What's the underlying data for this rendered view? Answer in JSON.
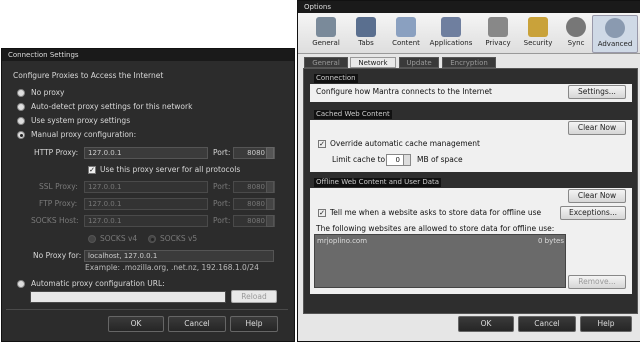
{
  "connection": {
    "title": "Connection Settings",
    "heading": "Configure Proxies to Access the Internet",
    "opt_no_proxy": "No proxy",
    "opt_auto_detect": "Auto-detect proxy settings for this network",
    "opt_system": "Use system proxy settings",
    "opt_manual": "Manual proxy configuration:",
    "http_label": "HTTP Proxy:",
    "http_value": "127.0.0.1",
    "port_label": "Port:",
    "http_port": "8080",
    "use_same": "Use this proxy server for all protocols",
    "ssl_label": "SSL Proxy:",
    "ssl_value": "127.0.0.1",
    "ssl_port": "8080",
    "ftp_label": "FTP Proxy:",
    "ftp_value": "127.0.0.1",
    "ftp_port": "8080",
    "socks_label": "SOCKS Host:",
    "socks_value": "127.0.0.1",
    "socks_port": "8080",
    "socks_v4": "SOCKS v4",
    "socks_v5": "SOCKS v5",
    "no_proxy_label": "No Proxy for:",
    "no_proxy_value": "localhost, 127.0.0.1",
    "example": "Example: .mozilla.org, .net.nz, 192.168.1.0/24",
    "opt_auto_url": "Automatic proxy configuration URL:",
    "auto_url_value": "",
    "reload": "Reload",
    "ok": "OK",
    "cancel": "Cancel",
    "help": "Help"
  },
  "options": {
    "title": "Options",
    "toolbar": [
      {
        "label": "General",
        "icon": "general-icon",
        "color": "#7a8a9a"
      },
      {
        "label": "Tabs",
        "icon": "tabs-icon",
        "color": "#5a6f8f"
      },
      {
        "label": "Content",
        "icon": "content-icon",
        "color": "#8aa0c0"
      },
      {
        "label": "Applications",
        "icon": "applications-icon",
        "color": "#6f7f9f"
      },
      {
        "label": "Privacy",
        "icon": "privacy-icon",
        "color": "#888888"
      },
      {
        "label": "Security",
        "icon": "security-icon",
        "color": "#c9a23a"
      },
      {
        "label": "Sync",
        "icon": "sync-icon",
        "color": "#777777"
      },
      {
        "label": "Advanced",
        "icon": "advanced-icon",
        "color": "#8a9ab0"
      }
    ],
    "tabs": [
      "General",
      "Network",
      "Update",
      "Encryption"
    ],
    "connection_header": "Connection",
    "connection_desc": "Configure how Mantra connects to the Internet",
    "settings_btn": "Settings...",
    "cache_header": "Cached Web Content",
    "clear_now_1": "Clear Now",
    "override_cache": "Override automatic cache management",
    "limit_cache": "Limit cache to",
    "cache_value": "0",
    "cache_unit": "MB of space",
    "offline_header": "Offline Web Content and User Data",
    "clear_now_2": "Clear Now",
    "tell_me": "Tell me when a website asks to store data for offline use",
    "exceptions": "Exceptions...",
    "allowed_text": "The following websites are allowed to store data for offline use:",
    "site_name": "mrjoplino.com",
    "site_size": "0 bytes",
    "remove": "Remove...",
    "ok": "OK",
    "cancel": "Cancel",
    "help": "Help"
  }
}
